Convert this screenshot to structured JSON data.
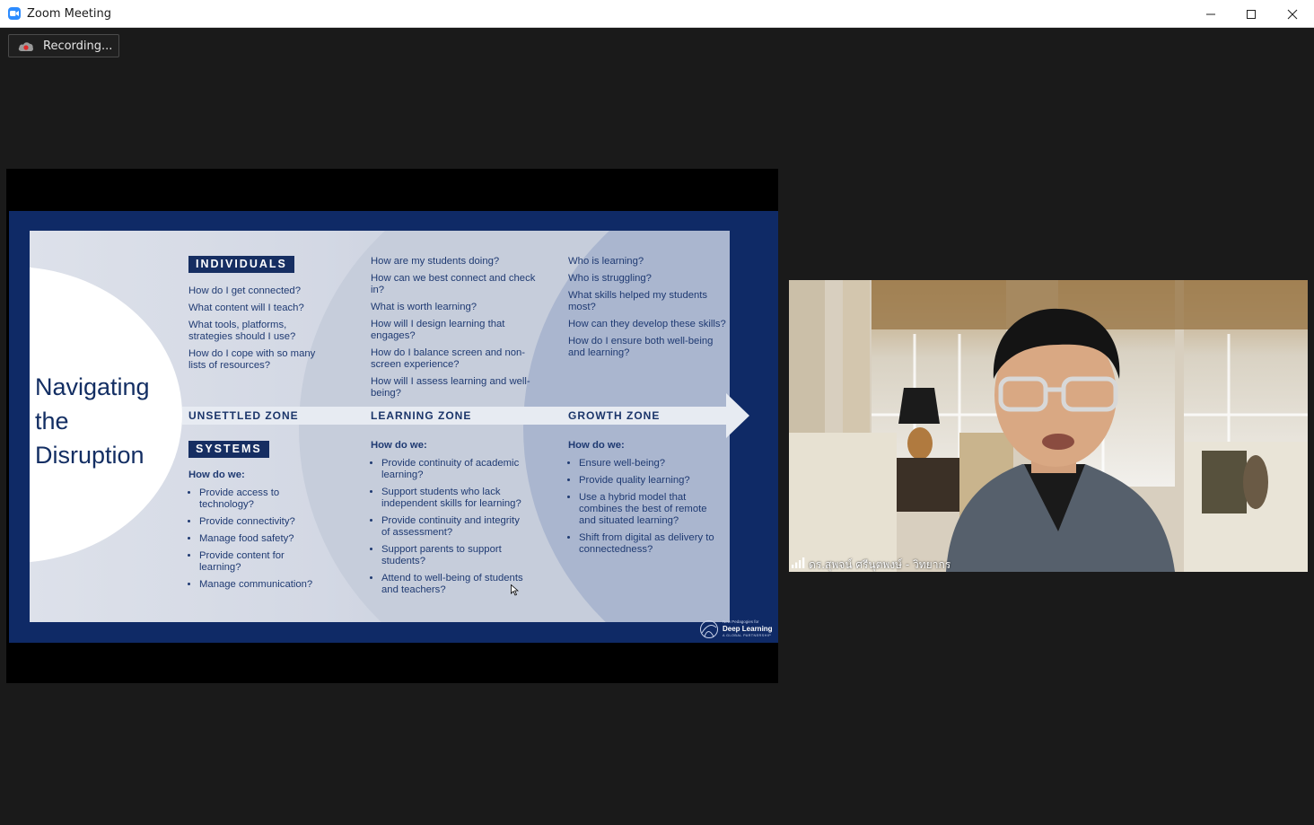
{
  "window": {
    "title": "Zoom Meeting",
    "controls": [
      "minimize",
      "maximize",
      "close"
    ]
  },
  "recording": {
    "label": "Recording..."
  },
  "share": {
    "slide": {
      "title": "Navigating the Disruption",
      "individuals_tag": "INDIVIDUALS",
      "systems_tag": "SYSTEMS",
      "zones": [
        "UNSETTLED ZONE",
        "LEARNING ZONE",
        "GROWTH ZONE"
      ],
      "unsettled_individuals": [
        "How do I get connected?",
        "What content will I teach?",
        "What tools, platforms, strategies should I use?",
        "How do I cope with so many lists of resources?"
      ],
      "learning_individuals": [
        "How are my students doing?",
        "How can we best connect and check in?",
        "What is worth learning?",
        "How will I design learning that engages?",
        "How do I balance screen and non-screen experience?",
        "How will I assess learning and well-being?"
      ],
      "growth_individuals": [
        "Who is learning?",
        "Who is struggling?",
        "What skills helped my students most?",
        "How can they develop these skills?",
        "How do I ensure both well-being and learning?"
      ],
      "how_do_we": "How do we:",
      "unsettled_systems": [
        "Provide access to technology?",
        "Provide connectivity?",
        "Manage food safety?",
        "Provide content for learning?",
        "Manage communication?"
      ],
      "learning_systems": [
        "Provide continuity of academic learning?",
        "Support students who lack independent skills for learning?",
        "Provide continuity and integrity of assessment?",
        "Support parents to support students?",
        "Attend to well-being of students and teachers?"
      ],
      "growth_systems": [
        "Ensure well-being?",
        "Provide quality learning?",
        "Use a hybrid model that combines the best of remote and situated learning?",
        "Shift from digital as delivery to connectedness?"
      ],
      "logo": {
        "small": "New Pedagogies for",
        "big": "Deep Learning",
        "sub": "A GLOBAL PARTNERSHIP"
      }
    }
  },
  "video": {
    "participant_name": "ดร.สุพจน์ ศรีนุตพงษ์ - วิทยากร"
  },
  "colors": {
    "background": "#1a1a1a",
    "slide_navy": "#0f2a66",
    "zoom_blue": "#2d8cff"
  }
}
